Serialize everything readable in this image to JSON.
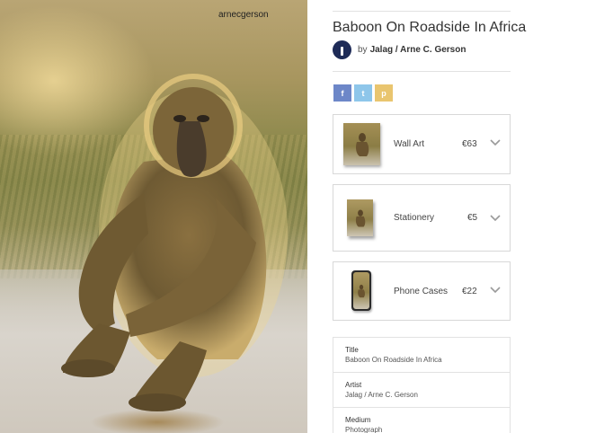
{
  "photo": {
    "watermark": "arnecgerson"
  },
  "artwork": {
    "title": "Baboon On Roadside In Africa",
    "by_prefix": "by",
    "artist": "Jalag / Arne C. Gerson"
  },
  "share": {
    "facebook": "f",
    "twitter": "t",
    "pinterest": "p"
  },
  "products": [
    {
      "name": "Wall Art",
      "price": "€63"
    },
    {
      "name": "Stationery",
      "price": "€5"
    },
    {
      "name": "Phone Cases",
      "price": "€22"
    }
  ],
  "details": [
    {
      "label": "Title",
      "value": "Baboon On Roadside In Africa"
    },
    {
      "label": "Artist",
      "value": "Jalag / Arne C. Gerson"
    },
    {
      "label": "Medium",
      "value": "Photograph"
    }
  ],
  "colors": {
    "avatar": "#1e2b57",
    "facebook": "#6d87c8",
    "twitter": "#8ec6ea",
    "pinterest": "#e9c56f"
  },
  "icons": {
    "avatar": "artist-logo-icon",
    "expand": "chevron-down-icon"
  }
}
